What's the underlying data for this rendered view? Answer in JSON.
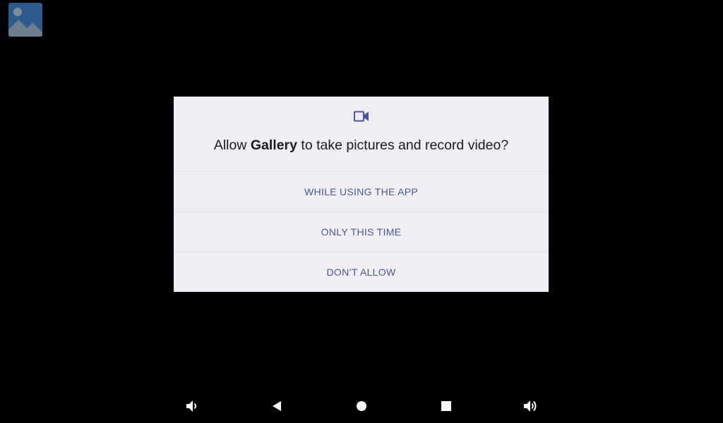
{
  "app_icon": {
    "name": "gallery-app-icon"
  },
  "dialog": {
    "icon": "videocam-icon",
    "title_prefix": "Allow ",
    "title_app": "Gallery",
    "title_suffix": " to take pictures and record video?",
    "buttons": {
      "while_using": "WHILE USING THE APP",
      "only_this_time": "ONLY THIS TIME",
      "dont_allow": "DON’T ALLOW"
    }
  },
  "navbar": {
    "items": [
      "volume-down-icon",
      "back-icon",
      "home-icon",
      "recents-icon",
      "volume-up-icon"
    ]
  },
  "colors": {
    "dialog_bg": "#f0eef3",
    "accent": "#4a5798",
    "text": "#1b1b1f",
    "screen_bg": "#000000"
  }
}
